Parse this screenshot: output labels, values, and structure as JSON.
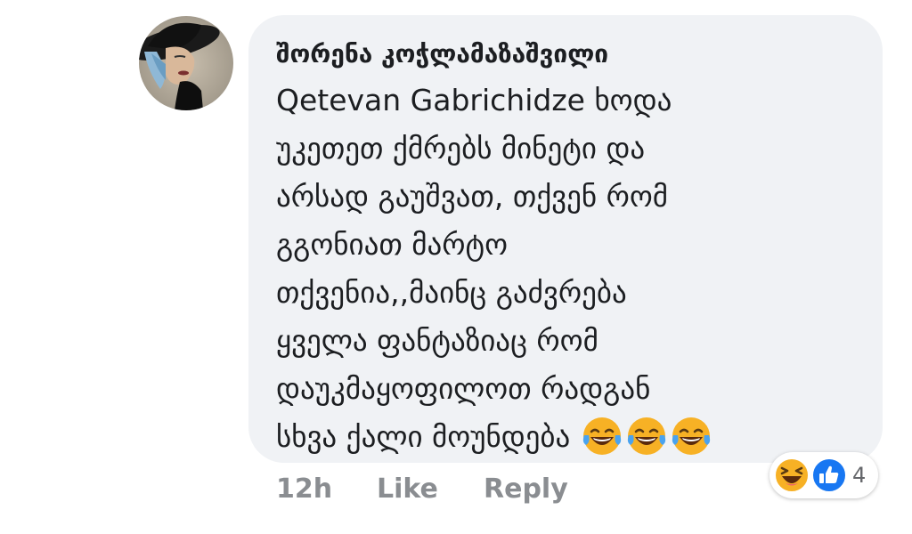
{
  "comment": {
    "author": "შორენა კოჭლამაზაშვილი",
    "lines": [
      "Qetevan Gabrichidze ხოდა",
      "უკეთეთ ქმრებს მინეტი და",
      "არსად გაუშვათ, თქვენ რომ",
      "გგონიათ მარტო",
      "თქვენია,,მაინც გაძვრება",
      "ყველა ფანტაზიაც რომ",
      "დაუკმაყოფილოთ რადგან",
      "სხვა ქალი მოუნდება"
    ],
    "emojis": [
      "tears-of-joy-emoji",
      "tears-of-joy-emoji",
      "tears-of-joy-emoji"
    ]
  },
  "meta": {
    "time": "12h",
    "like_label": "Like",
    "reply_label": "Reply"
  },
  "reactions": {
    "icons": [
      "laughing-reaction-icon",
      "like-reaction-icon"
    ],
    "count": "4"
  },
  "colors": {
    "bubble": "#f0f2f5",
    "text": "#1c1e21",
    "meta": "#8a8d91",
    "like_blue": "#1877f2",
    "emoji_yellow": "#f7b125"
  }
}
